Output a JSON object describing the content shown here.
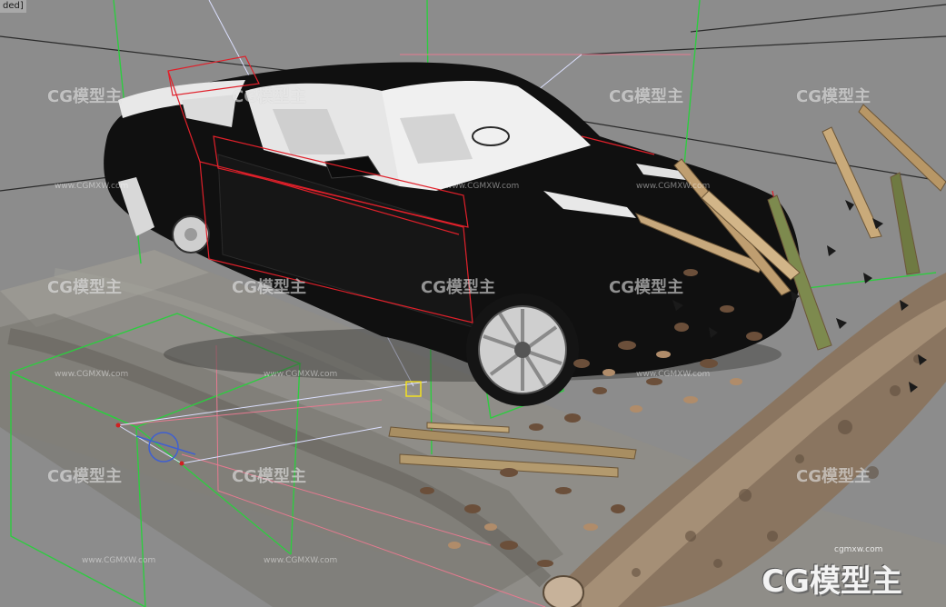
{
  "viewport": {
    "label": "ded]",
    "colors": {
      "background": "#8c8c8c",
      "grid_line": "#2a2a2a",
      "light_helper": "#2ecc40",
      "selection_bbox": "#e0202a",
      "camera_helper": "#4060d0",
      "road": "#8f8d88",
      "car_body": "#101010",
      "interior": "#e6e6e6",
      "log": "#8a7560"
    }
  },
  "watermarks": {
    "brand": "CG模型主",
    "url": "www.CGMXW.com",
    "big_brand": "CG模型主",
    "big_url": "cgmxw.com"
  }
}
